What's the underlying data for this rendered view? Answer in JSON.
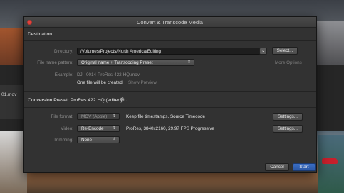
{
  "background": {
    "filename": "01.mov"
  },
  "dialog": {
    "title": "Convert & Transcode Media",
    "destination": {
      "header": "Destination",
      "directory_label": "Directory:",
      "directory_value": "/Volumes/Projects/North America/Editing",
      "select_button": "Select...",
      "pattern_label": "File name pattern:",
      "pattern_value": "Original name + Transcoding Preset",
      "more_options": "More Options",
      "example_label": "Example:",
      "example_value": "DJI_0014-ProRes-422-HQ.mov",
      "files_created": "One file will be created",
      "show_preview": "Show Preview"
    },
    "conversion": {
      "preset_label": "Conversion Preset: ProRes 422 HQ (edited)",
      "format_label": "File format:",
      "format_value": "MOV (Apple)",
      "format_desc": "Keep file timestamps, Source Timecode",
      "format_settings": "Settings...",
      "video_label": "Video:",
      "video_value": "Re-Encode",
      "video_desc": "ProRes, 3840x2160, 29.97 FPS Progressive",
      "video_settings": "Settings...",
      "trimming_label": "Trimming:",
      "trimming_value": "None"
    },
    "footer": {
      "cancel": "Cancel",
      "start": "Start"
    }
  },
  "colors": {
    "dialog_bg": "#323232",
    "primary_button": "#2f5fb3",
    "close_button": "#e0443e"
  },
  "icons": {
    "gear": "gear-icon",
    "chevron": "chevron-down-icon",
    "updown": "updown-arrows-icon"
  }
}
